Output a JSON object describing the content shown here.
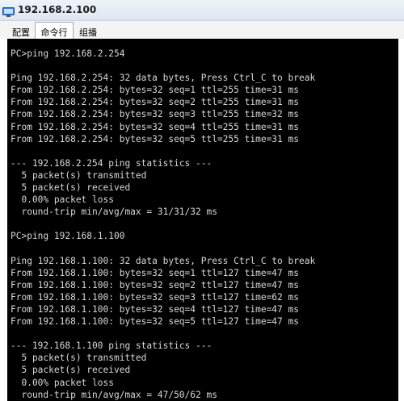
{
  "window": {
    "title": "192.168.2.100"
  },
  "tabs": [
    {
      "label": "配置",
      "active": false
    },
    {
      "label": "命令行",
      "active": true
    },
    {
      "label": "组播",
      "active": false
    }
  ],
  "terminal": {
    "lines": [
      "PC>ping 192.168.2.254",
      "",
      "Ping 192.168.2.254: 32 data bytes, Press Ctrl_C to break",
      "From 192.168.2.254: bytes=32 seq=1 ttl=255 time=31 ms",
      "From 192.168.2.254: bytes=32 seq=2 ttl=255 time=31 ms",
      "From 192.168.2.254: bytes=32 seq=3 ttl=255 time=32 ms",
      "From 192.168.2.254: bytes=32 seq=4 ttl=255 time=31 ms",
      "From 192.168.2.254: bytes=32 seq=5 ttl=255 time=31 ms",
      "",
      "--- 192.168.2.254 ping statistics ---",
      "  5 packet(s) transmitted",
      "  5 packet(s) received",
      "  0.00% packet loss",
      "  round-trip min/avg/max = 31/31/32 ms",
      "",
      "PC>ping 192.168.1.100",
      "",
      "Ping 192.168.1.100: 32 data bytes, Press Ctrl_C to break",
      "From 192.168.1.100: bytes=32 seq=1 ttl=127 time=47 ms",
      "From 192.168.1.100: bytes=32 seq=2 ttl=127 time=47 ms",
      "From 192.168.1.100: bytes=32 seq=3 ttl=127 time=62 ms",
      "From 192.168.1.100: bytes=32 seq=4 ttl=127 time=47 ms",
      "From 192.168.1.100: bytes=32 seq=5 ttl=127 time=47 ms",
      "",
      "--- 192.168.1.100 ping statistics ---",
      "  5 packet(s) transmitted",
      "  5 packet(s) received",
      "  0.00% packet loss",
      "  round-trip min/avg/max = 47/50/62 ms"
    ]
  },
  "colors": {
    "terminal_bg": "#000000",
    "terminal_fg": "#d8d8d8"
  },
  "icons": {
    "app": "computer-icon"
  }
}
